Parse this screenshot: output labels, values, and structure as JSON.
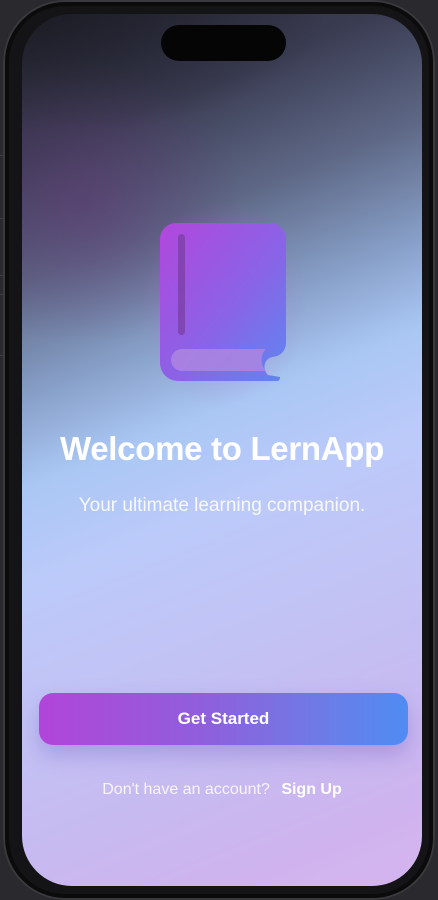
{
  "app_name": "LernApp",
  "welcome": {
    "title": "Welcome to LernApp",
    "subtitle": "Your ultimate learning companion."
  },
  "actions": {
    "primary_label": "Get Started",
    "signup_prompt": "Don't have an account?",
    "signup_link": "Sign Up"
  },
  "icons": {
    "hero": "book-icon"
  },
  "colors": {
    "accent_start": "#b145d9",
    "accent_end": "#4f8cf3",
    "text_primary": "#ffffff"
  }
}
